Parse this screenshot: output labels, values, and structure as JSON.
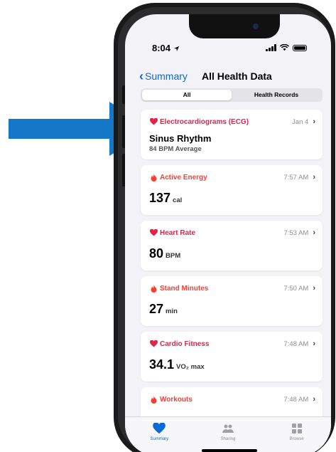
{
  "colors": {
    "arrow": "#1577c8",
    "accent_blue": "#0a6ad8",
    "heart_red": "#e0234c",
    "activity_red": "#ff3b30"
  },
  "status_bar": {
    "time": "8:04"
  },
  "nav": {
    "back_label": "Summary",
    "title": "All Health Data"
  },
  "segments": [
    {
      "label": "All",
      "selected": true
    },
    {
      "label": "Health Records",
      "selected": false
    }
  ],
  "cards": [
    {
      "icon": "heart-icon",
      "label": "Electrocardiograms (ECG)",
      "time": "Jan 4",
      "title": "Sinus Rhythm",
      "subtitle": "84 BPM Average"
    },
    {
      "icon": "flame-icon",
      "label": "Active Energy",
      "time": "7:57 AM",
      "value": "137",
      "unit": "cal"
    },
    {
      "icon": "heart-icon",
      "label": "Heart Rate",
      "time": "7:53 AM",
      "value": "80",
      "unit": "BPM"
    },
    {
      "icon": "flame-icon",
      "label": "Stand Minutes",
      "time": "7:50 AM",
      "value": "27",
      "unit": "min"
    },
    {
      "icon": "heart-icon",
      "label": "Cardio Fitness",
      "time": "7:48 AM",
      "value": "34.1",
      "unit": "VO₂ max"
    },
    {
      "icon": "flame-icon",
      "label": "Workouts",
      "time": "7:48 AM"
    }
  ],
  "tabbar": [
    {
      "icon": "heart-icon",
      "label": "Summary",
      "selected": true
    },
    {
      "icon": "sharing-icon",
      "label": "Sharing",
      "selected": false
    },
    {
      "icon": "browse-grid-icon",
      "label": "Browse",
      "selected": false
    }
  ]
}
